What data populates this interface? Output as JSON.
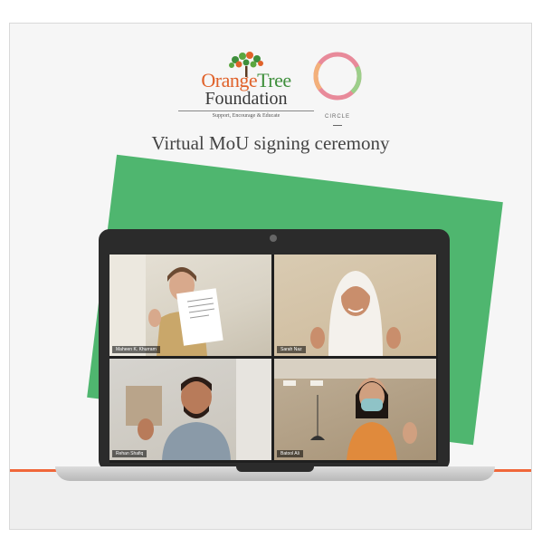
{
  "brand": {
    "orange_word": "Orange",
    "green_word": "Tree",
    "foundation": "Foundation",
    "tagline": "Support, Encourage & Educate",
    "partner": "CIRCLE"
  },
  "headline": "Virtual MoU signing ceremony",
  "participants": [
    {
      "name": "Maheen K. Khurram"
    },
    {
      "name": "Sarah Naz"
    },
    {
      "name": "Rehan Shafiq"
    },
    {
      "name": "Batool Ali"
    }
  ],
  "colors": {
    "accent_orange": "#e0622a",
    "accent_green": "#3f8f3c",
    "card_green": "#4fb66f",
    "laptop": "#2b2b2b"
  },
  "icons": [
    "tree-icon",
    "circle-logo-icon",
    "camera-icon"
  ]
}
